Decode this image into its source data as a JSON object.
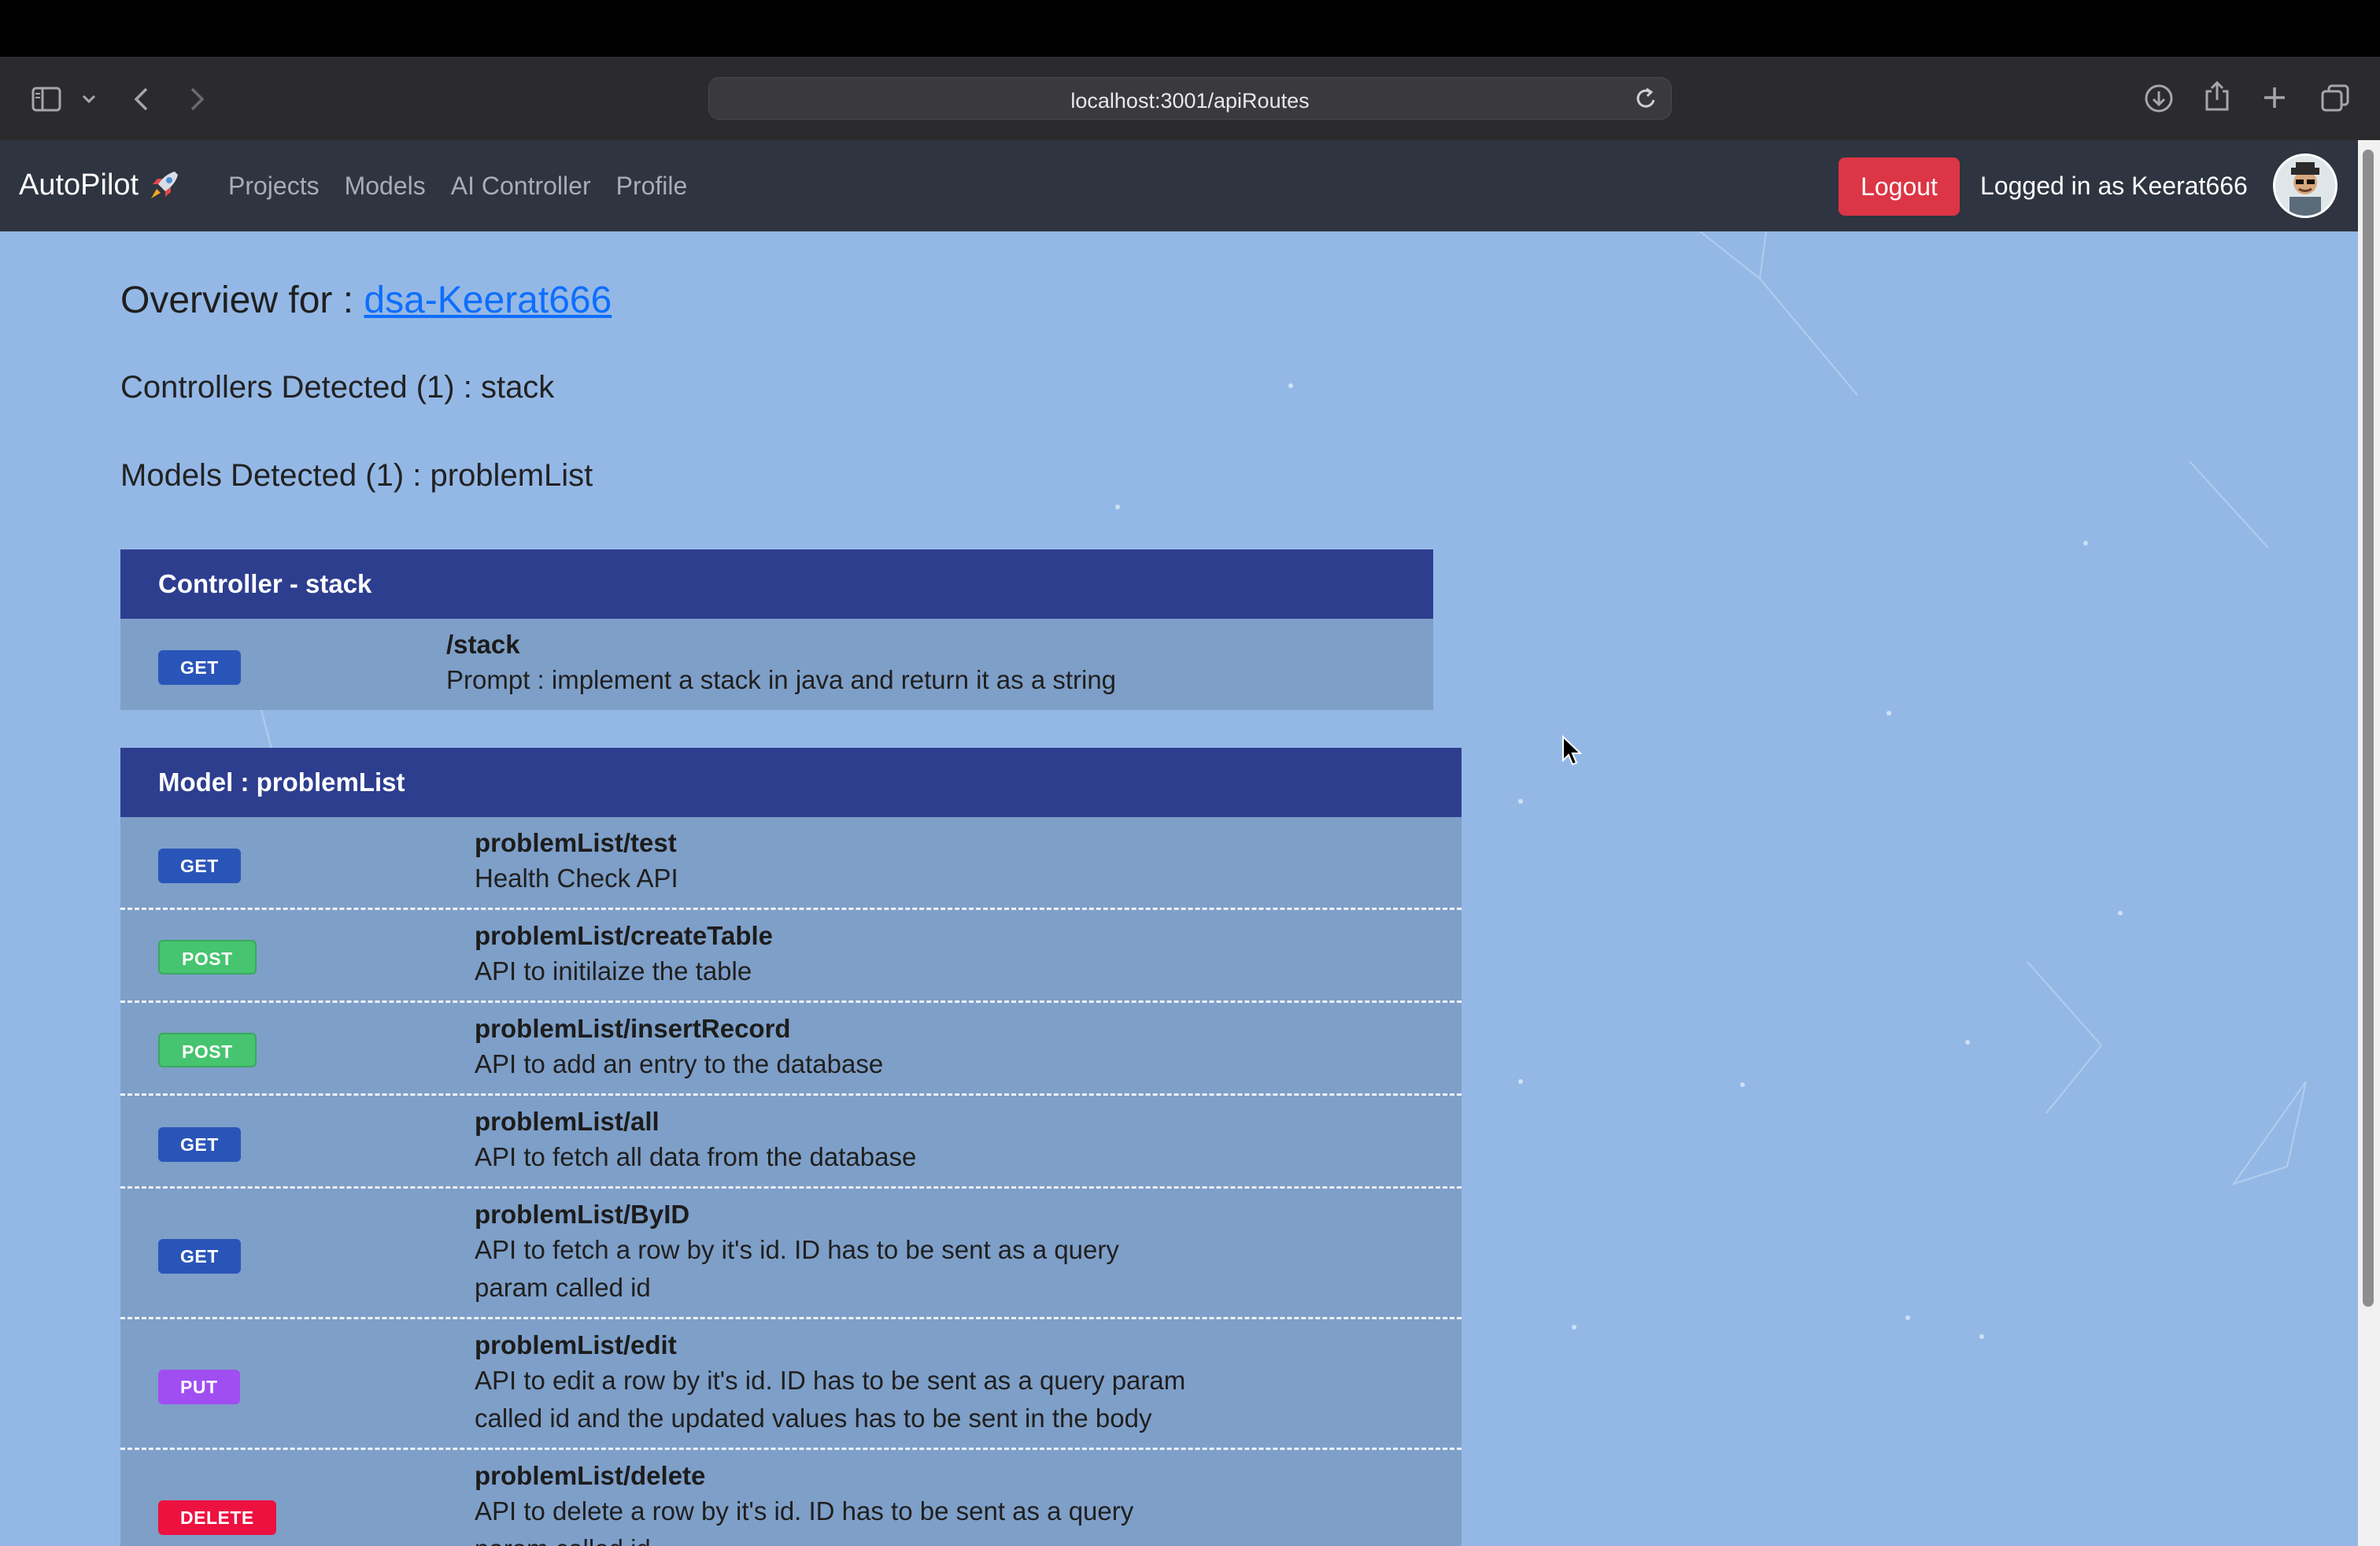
{
  "browser": {
    "url": "localhost:3001/apiRoutes",
    "icons": [
      "sidebar-icon",
      "chevron-down-icon",
      "back-icon",
      "forward-icon",
      "reload-icon",
      "download-icon",
      "share-icon",
      "new-tab-icon",
      "tabs-overview-icon"
    ]
  },
  "navbar": {
    "brand": "AutoPilot",
    "brand_icon": "rocket-icon",
    "links": [
      "Projects",
      "Models",
      "AI Controller",
      "Profile"
    ],
    "logout_label": "Logout",
    "logged_in_text": "Logged in as Keerat666"
  },
  "overview": {
    "prefix": "Overview for :",
    "project_link": "dsa-Keerat666",
    "controllers_detected": "Controllers Detected (1) : stack",
    "models_detected": "Models Detected (1) : problemList"
  },
  "controller_panel": {
    "title": "Controller - stack",
    "routes": [
      {
        "method": "GET",
        "path": "/stack",
        "description": "Prompt : implement a stack in java and return it as a string"
      }
    ]
  },
  "model_panel": {
    "title": "Model : problemList",
    "routes": [
      {
        "method": "GET",
        "path": "problemList/test",
        "description": "Health Check API"
      },
      {
        "method": "POST",
        "path": "problemList/createTable",
        "description": "API to initilaize the table"
      },
      {
        "method": "POST",
        "path": "problemList/insertRecord",
        "description": "API to add an entry to the database"
      },
      {
        "method": "GET",
        "path": "problemList/all",
        "description": "API to fetch all data from the database"
      },
      {
        "method": "GET",
        "path": "problemList/ByID",
        "description": "API to fetch a row by it's id. ID has to be sent as a query param called id"
      },
      {
        "method": "PUT",
        "path": "problemList/edit",
        "description": "API to edit a row by it's id. ID has to be sent as a query param called id and the updated values has to be sent in the body"
      },
      {
        "method": "DELETE",
        "path": "problemList/delete",
        "description": "API to delete a row by it's id. ID has to be sent as a query param called id"
      }
    ]
  },
  "colors": {
    "navbar_bg": "#2e3440",
    "page_bg": "#94b8e6",
    "panel_header": "#2d3e8f",
    "panel_body": "#7e9fc8",
    "logout": "#dc3545",
    "get": "#2a55b8",
    "post": "#46c46f",
    "put": "#a04ef2",
    "delete": "#ed1140",
    "link": "#0d6efd"
  }
}
